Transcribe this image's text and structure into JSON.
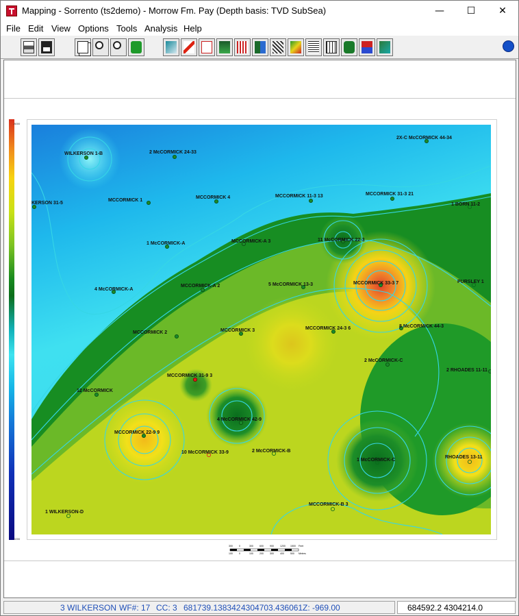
{
  "window": {
    "title": "Mapping - Sorrento (ts2demo) - Morrow Fm. Pay  (Depth basis:  TVD SubSea)",
    "minimize_glyph": "—",
    "maximize_glyph": "☐",
    "close_glyph": "✕"
  },
  "menu": {
    "items": [
      {
        "label": "File"
      },
      {
        "label": "Edit"
      },
      {
        "label": "View"
      },
      {
        "label": "Options"
      },
      {
        "label": "Tools"
      },
      {
        "label": "Analysis"
      },
      {
        "label": "Help"
      }
    ]
  },
  "toolbar": {
    "buttons": [
      "print-icon",
      "save-icon",
      "copy-icon",
      "zoom-in-icon",
      "zoom-out-icon",
      "refresh-icon",
      "map-view-icon",
      "xyz-icon",
      "cross-section-icon",
      "wells-icon",
      "grid-icon",
      "well-symbol-icon",
      "faults-icon",
      "contour-icon",
      "list-icon",
      "report-icon",
      "legend-icon",
      "toolbox-icon",
      "layers-icon",
      "help-icon"
    ]
  },
  "colorbar": {
    "top_label": "-8000",
    "bottom_label": "-9200"
  },
  "map": {
    "wells": [
      {
        "label": "WILKERSON  1-B",
        "symbol": "oil"
      },
      {
        "label": "2 McCORMICK 24-33",
        "symbol": "oil"
      },
      {
        "label": "2X-C McCORMICK 44-34",
        "symbol": "oil"
      },
      {
        "label": "KERSON 31-5",
        "symbol": "oil"
      },
      {
        "label": "MCCORMICK  1",
        "symbol": "oil"
      },
      {
        "label": "MCCORMICK  4",
        "symbol": "oil"
      },
      {
        "label": "MCCORMICK 11-3  13",
        "symbol": "oil"
      },
      {
        "label": "MCCORMICK 31-3  21",
        "symbol": "oil"
      },
      {
        "label": "1 BORN 11-2",
        "symbol": "dry"
      },
      {
        "label": "1 McCORMICK-A",
        "symbol": "oil"
      },
      {
        "label": "MCCORMICK-A  3",
        "symbol": "oil"
      },
      {
        "label": "11 McCORMICK 22-3",
        "symbol": "oil"
      },
      {
        "label": "4 McCORMICK-A",
        "symbol": "oil"
      },
      {
        "label": "MCCORMICK-A  2",
        "symbol": "oil"
      },
      {
        "label": "5 McCORMICK 13-3",
        "symbol": "oil"
      },
      {
        "label": "MCCORMICK 33-3  7",
        "symbol": "oil"
      },
      {
        "label": "PURSLEY  1",
        "symbol": "dry"
      },
      {
        "label": "MCCORMICK  2",
        "symbol": "oil"
      },
      {
        "label": "MCCORMICK  3",
        "symbol": "oil"
      },
      {
        "label": "MCCORMICK 24-3  6",
        "symbol": "oil"
      },
      {
        "label": "8 McCORMICK 44-3",
        "symbol": "oil"
      },
      {
        "label": "2 McCORMICK-C",
        "symbol": "oil"
      },
      {
        "label": "2 RHOADES 11-11",
        "symbol": "oil"
      },
      {
        "label": "MCCORMICK 31-9  3",
        "symbol": "selected"
      },
      {
        "label": "12 McCORMICK",
        "symbol": "oil"
      },
      {
        "label": "4 McCORMICK 42-9",
        "symbol": "oil"
      },
      {
        "label": "MCCORMICK 22-9  9",
        "symbol": "oil"
      },
      {
        "label": "10 McCORMICK 33-9",
        "symbol": "highlight"
      },
      {
        "label": "2 McCORMICK-B",
        "symbol": "dry"
      },
      {
        "label": "1 McCORMICK-C",
        "symbol": "dry"
      },
      {
        "label": "RHOADES 13-11",
        "symbol": "dry"
      },
      {
        "label": "1 WILKERSON-D",
        "symbol": "dry"
      },
      {
        "label": "MCCORMICK-B  3",
        "symbol": "dry"
      }
    ]
  },
  "scale_bar": {
    "feet_ticks": [
      "300",
      "0",
      "300",
      "600",
      "900",
      "1200",
      "1500"
    ],
    "feet_unit": "Feet",
    "meters_ticks": [
      "100",
      "0",
      "100",
      "200",
      "300",
      "400",
      "500"
    ],
    "meters_unit": "Meters"
  },
  "status": {
    "well": "3 WILKERSON",
    "wf": "WF#: 17",
    "cc": "CC: 3",
    "x": "681739.138342",
    "y": "4304703.436061",
    "z": "Z:   -969.00",
    "cursor": "684592.2   4304214.0"
  },
  "colors": {
    "status_text": "#1f4fb8",
    "selected_well": "#e01818",
    "oil_well": "#1a8a2a"
  }
}
